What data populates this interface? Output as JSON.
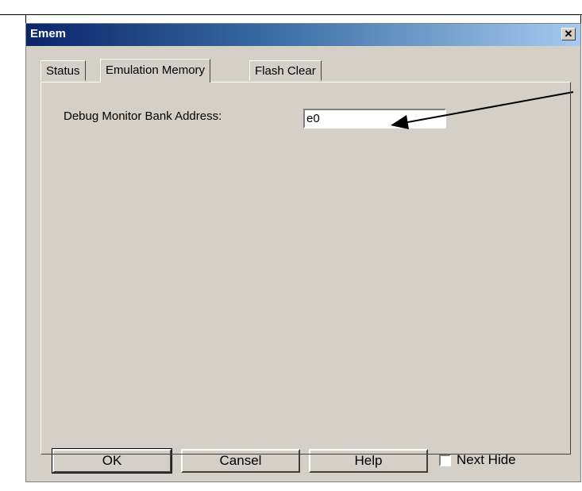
{
  "window": {
    "title": "Emem"
  },
  "tabs": [
    {
      "label": "Status",
      "active": false
    },
    {
      "label": "Emulation Memory",
      "active": true
    },
    {
      "label": "Flash Clear",
      "active": false
    }
  ],
  "form": {
    "debug_monitor_label": "Debug Monitor Bank Address:",
    "debug_monitor_value": "e0"
  },
  "buttons": {
    "ok": "OK",
    "cancel": "Cansel",
    "help": "Help"
  },
  "next_hide": {
    "label": "Next Hide",
    "checked": false
  },
  "icons": {
    "close": "close-icon"
  }
}
